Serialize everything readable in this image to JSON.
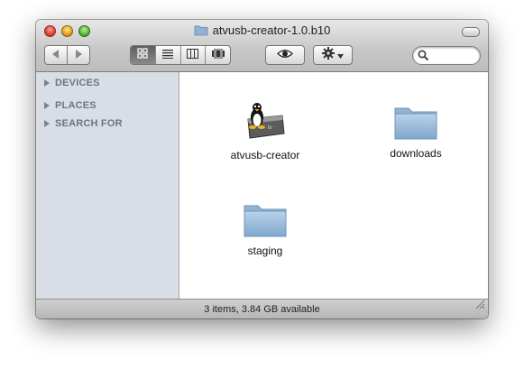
{
  "window": {
    "title": "atvusb-creator-1.0.b10"
  },
  "toolbar": {
    "back_icon": "back-arrow-icon",
    "forward_icon": "forward-arrow-icon",
    "view_modes": [
      "icon-view-icon",
      "list-view-icon",
      "column-view-icon",
      "coverflow-view-icon"
    ],
    "quicklook_icon": "eye-icon",
    "action_icon": "gear-icon",
    "search": {
      "placeholder": "",
      "value": ""
    }
  },
  "sidebar": {
    "sections": [
      {
        "label": "DEVICES"
      },
      {
        "label": "PLACES"
      },
      {
        "label": "SEARCH FOR"
      }
    ]
  },
  "content": {
    "items": [
      {
        "label": "atvusb-creator",
        "icon": "apple-tv-tux-app-icon"
      },
      {
        "label": "downloads",
        "icon": "folder-icon"
      },
      {
        "label": "staging",
        "icon": "folder-icon"
      }
    ]
  },
  "status": {
    "text": "3 items, 3.84 GB available"
  },
  "colors": {
    "sidebar_bg": "#d9dee6",
    "folder_blue": "#8fb3d3"
  }
}
